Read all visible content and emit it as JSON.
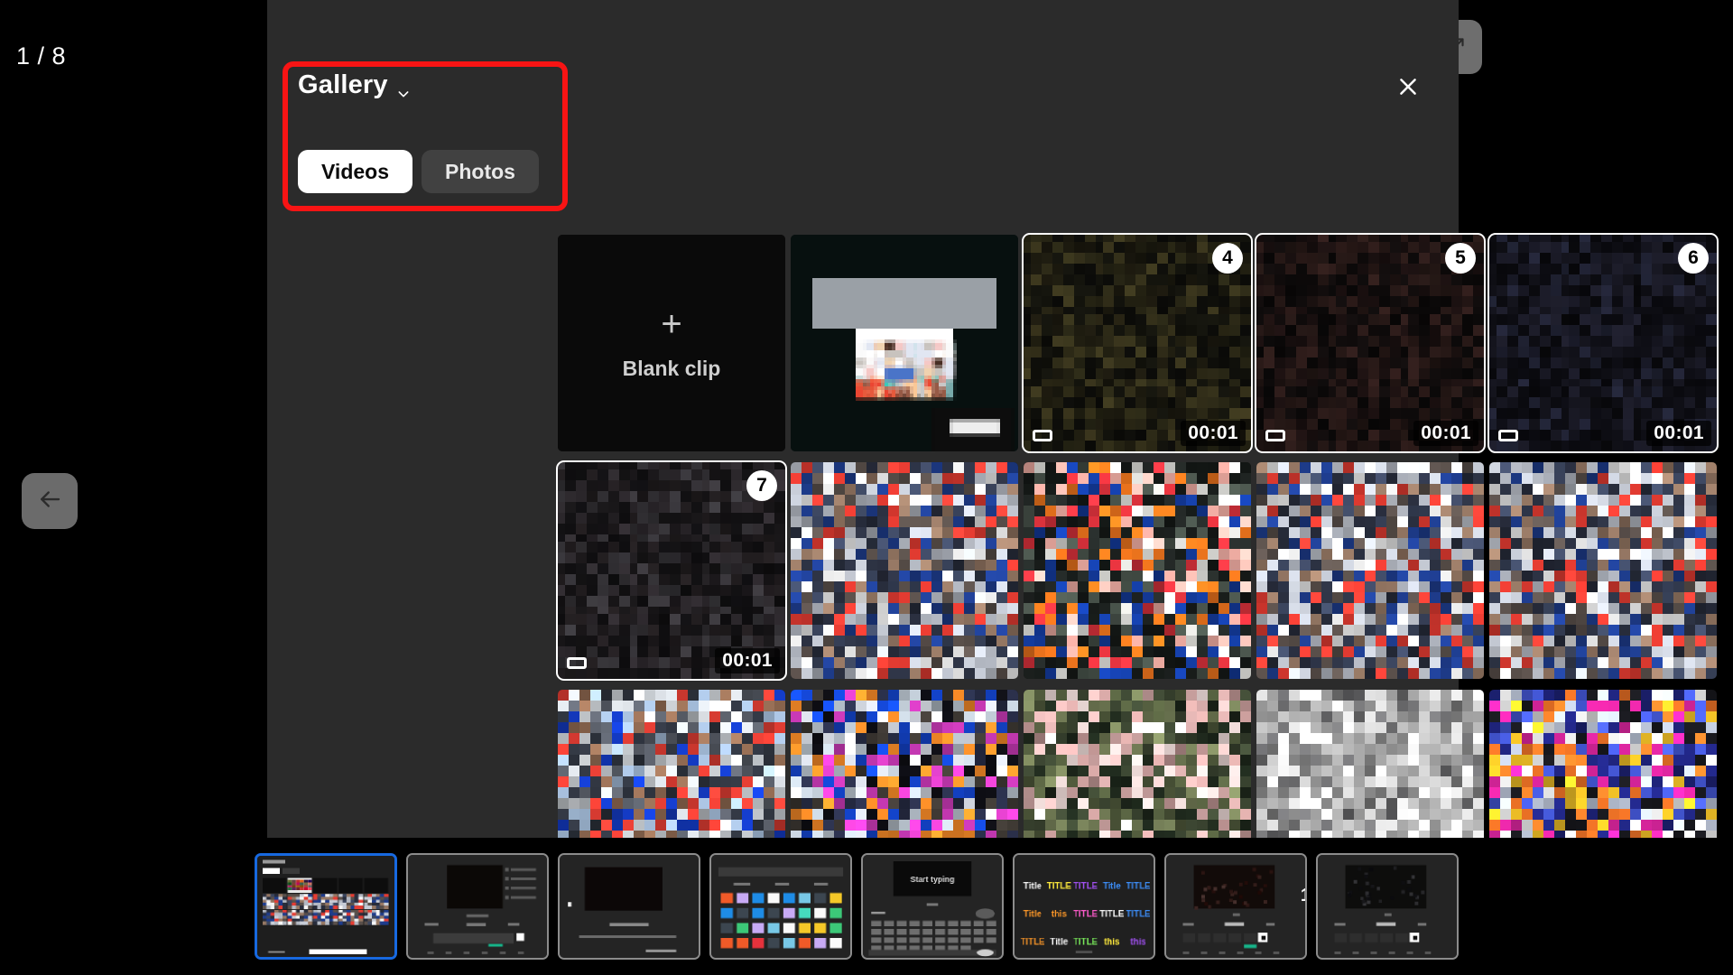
{
  "counter": {
    "label": "1 / 8"
  },
  "toolbar": {
    "zoom_icon": "zoom-in-icon",
    "expand_icon": "expand-arrows-icon"
  },
  "nav": {
    "prev_icon": "arrow-left-icon",
    "next_icon": "arrow-right-icon"
  },
  "panel": {
    "title": "Gallery",
    "title_chevron": "chevron-down-icon",
    "close_icon": "close-icon",
    "tabs": [
      {
        "label": "Videos",
        "active": true
      },
      {
        "label": "Photos",
        "active": false
      }
    ]
  },
  "annotation": {
    "color": "#f81414",
    "target": "gallery-header-and-tabs"
  },
  "grid": {
    "blank_clip": {
      "label": "Blank clip",
      "icon": "plus-icon"
    },
    "items": [
      {
        "kind": "blank",
        "selected": false
      },
      {
        "kind": "photo",
        "selected": false,
        "seed": 11,
        "style": "screen"
      },
      {
        "kind": "video",
        "selected": true,
        "badge": "4",
        "duration": "00:01",
        "seed": 21,
        "style": "darkleaf"
      },
      {
        "kind": "video",
        "selected": true,
        "badge": "5",
        "duration": "00:01",
        "seed": 22,
        "style": "darkred"
      },
      {
        "kind": "video",
        "selected": true,
        "badge": "6",
        "duration": "00:01",
        "seed": 23,
        "style": "darkblue"
      },
      {
        "kind": "video",
        "selected": true,
        "badge": "7",
        "duration": "00:01",
        "seed": 24,
        "style": "darksmoke"
      },
      {
        "kind": "photo",
        "selected": false,
        "seed": 31,
        "style": "crowd"
      },
      {
        "kind": "photo",
        "selected": false,
        "seed": 32,
        "style": "stage"
      },
      {
        "kind": "photo",
        "selected": false,
        "seed": 33,
        "style": "crowd"
      },
      {
        "kind": "photo",
        "selected": false,
        "seed": 34,
        "style": "crowd"
      },
      {
        "kind": "photo",
        "selected": false,
        "seed": 41,
        "style": "bluecrowd"
      },
      {
        "kind": "photo",
        "selected": false,
        "seed": 42,
        "style": "darkcrowd"
      },
      {
        "kind": "photo",
        "selected": false,
        "seed": 43,
        "style": "pinksky"
      },
      {
        "kind": "photo",
        "selected": false,
        "seed": 44,
        "style": "graywall"
      },
      {
        "kind": "photo",
        "selected": false,
        "seed": 45,
        "style": "neon"
      }
    ]
  },
  "filmstrip": {
    "items": [
      {
        "style": "gallery-screen",
        "selected": true,
        "label": ""
      },
      {
        "style": "editor-menu",
        "selected": false,
        "label": ""
      },
      {
        "style": "caption-screen",
        "selected": false,
        "label": ""
      },
      {
        "style": "sticker-grid",
        "selected": false,
        "label": ""
      },
      {
        "style": "keyboard",
        "selected": false,
        "label": "Start typing"
      },
      {
        "style": "title-styles",
        "selected": false,
        "label": ""
      },
      {
        "style": "timeline-a",
        "selected": false,
        "label": "1"
      },
      {
        "style": "timeline-b",
        "selected": false,
        "label": ""
      }
    ]
  },
  "colors": {
    "panel_bg": "#2b2b2b",
    "page_bg": "#000000",
    "accent_selected": "#ffffff",
    "filmstrip_selected": "#1769e0",
    "annotation": "#f81414",
    "button_bg": "#6e6e6e"
  }
}
